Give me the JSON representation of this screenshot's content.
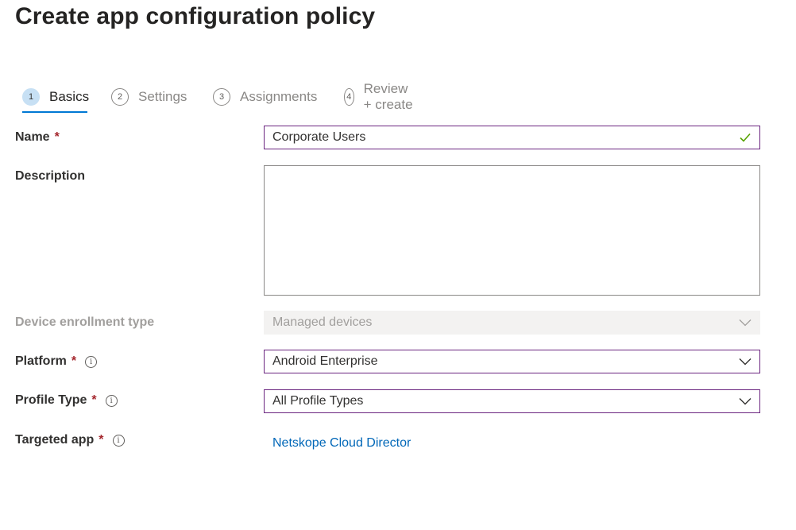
{
  "page": {
    "title": "Create app configuration policy"
  },
  "wizard": {
    "steps": [
      {
        "num": "1",
        "label": "Basics",
        "active": true
      },
      {
        "num": "2",
        "label": "Settings"
      },
      {
        "num": "3",
        "label": "Assignments"
      },
      {
        "num": "4",
        "label": "Review + create"
      }
    ]
  },
  "form": {
    "name": {
      "label": "Name",
      "required": "*",
      "value": "Corporate Users"
    },
    "description": {
      "label": "Description",
      "value": ""
    },
    "enrollment": {
      "label": "Device enrollment type",
      "value": "Managed devices"
    },
    "platform": {
      "label": "Platform",
      "required": "*",
      "value": "Android Enterprise"
    },
    "profile_type": {
      "label": "Profile Type",
      "required": "*",
      "value": "All Profile Types"
    },
    "targeted_app": {
      "label": "Targeted app",
      "required": "*",
      "value": "Netskope Cloud Director"
    }
  },
  "icons": {
    "info": "i",
    "check_color": "#57a300",
    "accent": "#0078d4",
    "focus_border": "#6b2580",
    "required_color": "#a4262c"
  }
}
